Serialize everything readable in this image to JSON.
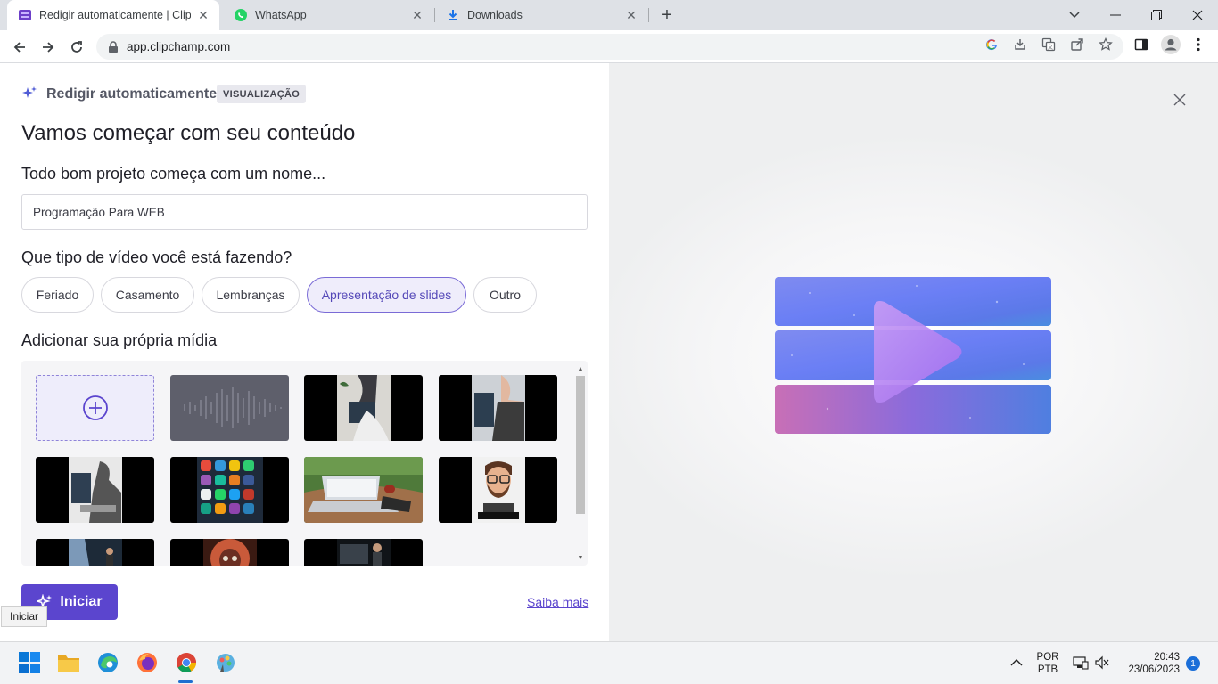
{
  "browser": {
    "tabs": [
      {
        "title": "Redigir automaticamente | Clipch",
        "active": true
      },
      {
        "title": "WhatsApp",
        "active": false
      },
      {
        "title": "Downloads",
        "active": false
      }
    ],
    "url": "app.clipchamp.com"
  },
  "app": {
    "feature_title": "Redigir automaticamente",
    "badge": "VISUALIZAÇÃO",
    "heading": "Vamos começar com seu conteúdo",
    "name_prompt": "Todo bom projeto começa com um nome...",
    "name_value": "Programação Para WEB",
    "type_prompt": "Que tipo de vídeo você está fazendo?",
    "video_types": [
      "Feriado",
      "Casamento",
      "Lembranças",
      "Apresentação de slides",
      "Outro"
    ],
    "selected_type": "Apresentação de slides",
    "media_prompt": "Adicionar sua própria mídia",
    "media_items": [
      "add-media",
      "audio-waveform",
      "person-laptop-dark",
      "person-laptop-illustration",
      "person-computer-illustration",
      "app-icons-phone",
      "laptop-on-table",
      "cartoon-avatar",
      "presenter-stage",
      "red-skull-figure",
      "presenter-screen"
    ],
    "start_label": "Iniciar",
    "learn_more": "Saiba mais",
    "tooltip": "Iniciar"
  },
  "taskbar": {
    "language_line1": "POR",
    "language_line2": "PTB",
    "time": "20:43",
    "date": "23/06/2023",
    "notification_count": "1"
  },
  "colors": {
    "accent": "#5b45ce",
    "chip_selected_bg": "#efedfb",
    "tab_bar": "#dee1e6"
  }
}
